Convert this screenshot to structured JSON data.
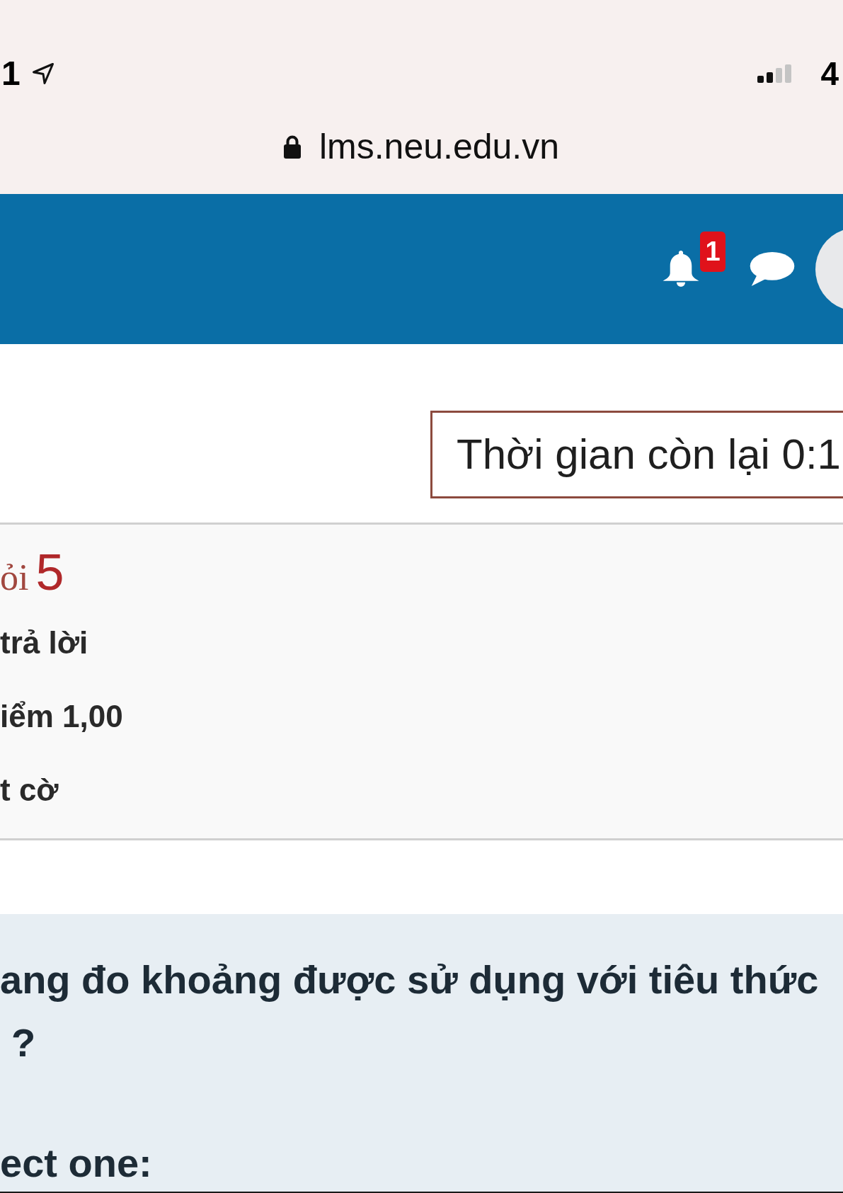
{
  "status_bar": {
    "time": "1",
    "network": "4"
  },
  "address_bar": {
    "url": "lms.neu.edu.vn"
  },
  "navbar": {
    "notification_count": "1"
  },
  "timer": {
    "text": "Thời gian còn lại 0:1"
  },
  "question_info": {
    "label": "ỏi",
    "number": "5",
    "status": "trả lời",
    "marks": "iểm 1,00",
    "flag_link": "t cờ"
  },
  "question": {
    "text_lines": [
      "ang đo khoảng được sử dụng với tiêu thức",
      "?"
    ],
    "prompt": "ect one:"
  }
}
